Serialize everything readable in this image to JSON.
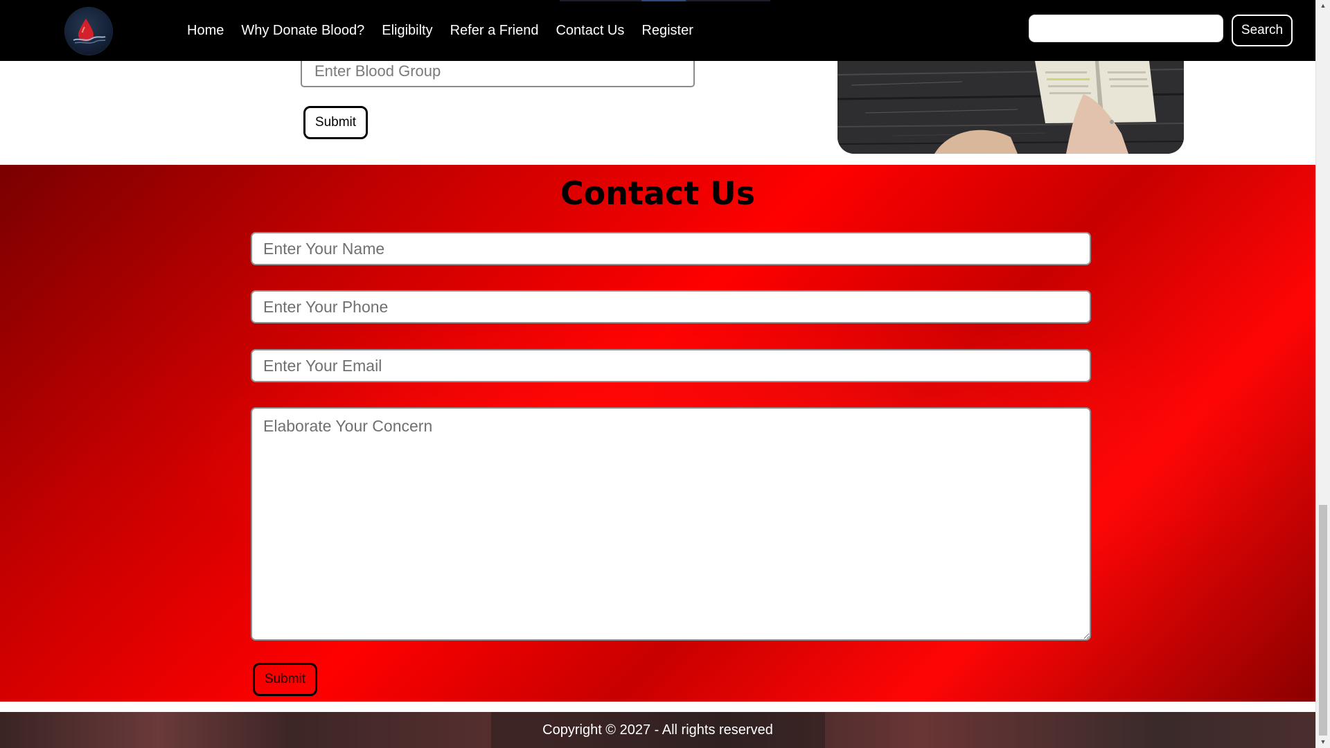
{
  "navbar": {
    "logo_icon": "blood-drop-logo",
    "links": [
      {
        "label": "Home"
      },
      {
        "label": "Why Donate Blood?"
      },
      {
        "label": "Eligibilty"
      },
      {
        "label": "Refer a Friend"
      },
      {
        "label": "Contact Us"
      },
      {
        "label": "Register"
      }
    ],
    "search": {
      "value": "",
      "button_label": "Search"
    }
  },
  "register": {
    "blood_group_placeholder": "Enter Blood Group",
    "submit_label": "Submit"
  },
  "contact": {
    "title": "Contact Us",
    "name_placeholder": "Enter Your Name",
    "phone_placeholder": "Enter Your Phone",
    "email_placeholder": "Enter Your Email",
    "concern_placeholder": "Elaborate Your Concern",
    "submit_label": "Submit"
  },
  "footer": {
    "copyright": "Copyright © 2027 - All rights reserved"
  },
  "colors": {
    "navbar_bg": "#000000",
    "contact_bg_accent": "#ff0000",
    "contact_bg_dark": "#7a0000",
    "text_light": "#ffffff",
    "text_dark": "#000000"
  },
  "scrollbar": {
    "position_fraction": 0.95
  }
}
